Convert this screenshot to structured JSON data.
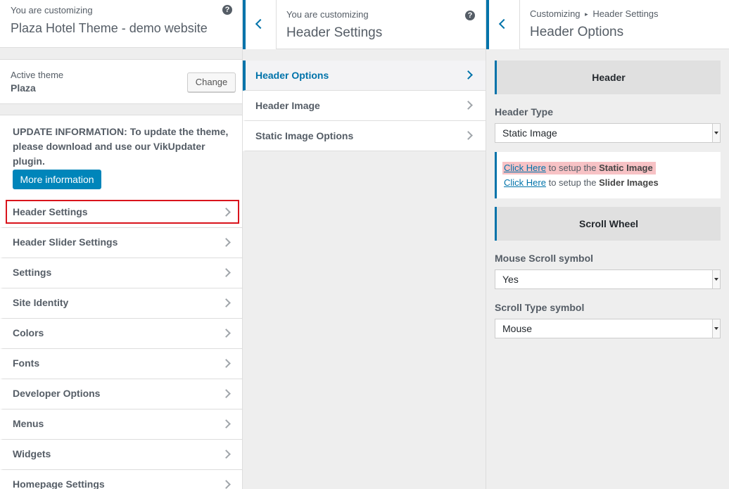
{
  "panel1": {
    "customizing_label": "You are customizing",
    "site_title": "Plaza Hotel Theme - demo website",
    "help_icon": "?",
    "active_theme_label": "Active theme",
    "active_theme_name": "Plaza",
    "change_label": "Change",
    "update_text": "UPDATE INFORMATION: To update the theme, please download and use our VikUpdater plugin.",
    "more_info_label": "More information",
    "menu_items": [
      {
        "label": "Header Settings"
      },
      {
        "label": "Header Slider Settings"
      },
      {
        "label": "Settings"
      },
      {
        "label": "Site Identity"
      },
      {
        "label": "Colors"
      },
      {
        "label": "Fonts"
      },
      {
        "label": "Developer Options"
      },
      {
        "label": "Menus"
      },
      {
        "label": "Widgets"
      },
      {
        "label": "Homepage Settings"
      }
    ]
  },
  "panel2": {
    "customizing_label": "You are customizing",
    "title": "Header Settings",
    "help_icon": "?",
    "items": [
      {
        "label": "Header Options"
      },
      {
        "label": "Header Image"
      },
      {
        "label": "Static Image Options"
      }
    ]
  },
  "panel3": {
    "breadcrumb_parent": "Customizing",
    "breadcrumb_sep": "▸",
    "breadcrumb_current": "Header Settings",
    "title": "Header Options",
    "header_section": "Header",
    "header_type_label": "Header Type",
    "header_type_value": "Static Image",
    "link1_text": "Click Here",
    "link1_rest": " to setup the ",
    "link1_bold": "Static Image",
    "link2_text": "Click Here",
    "link2_rest": " to setup the ",
    "link2_bold": "Slider Images",
    "scroll_section": "Scroll Wheel",
    "mouse_scroll_label": "Mouse Scroll symbol",
    "mouse_scroll_value": "Yes",
    "scroll_type_label": "Scroll Type symbol",
    "scroll_type_value": "Mouse"
  },
  "colors": {
    "accent": "#0073aa",
    "button_primary": "#0085ba",
    "selection_outline": "#d9141c",
    "link_highlight": "#f7c2c5"
  }
}
